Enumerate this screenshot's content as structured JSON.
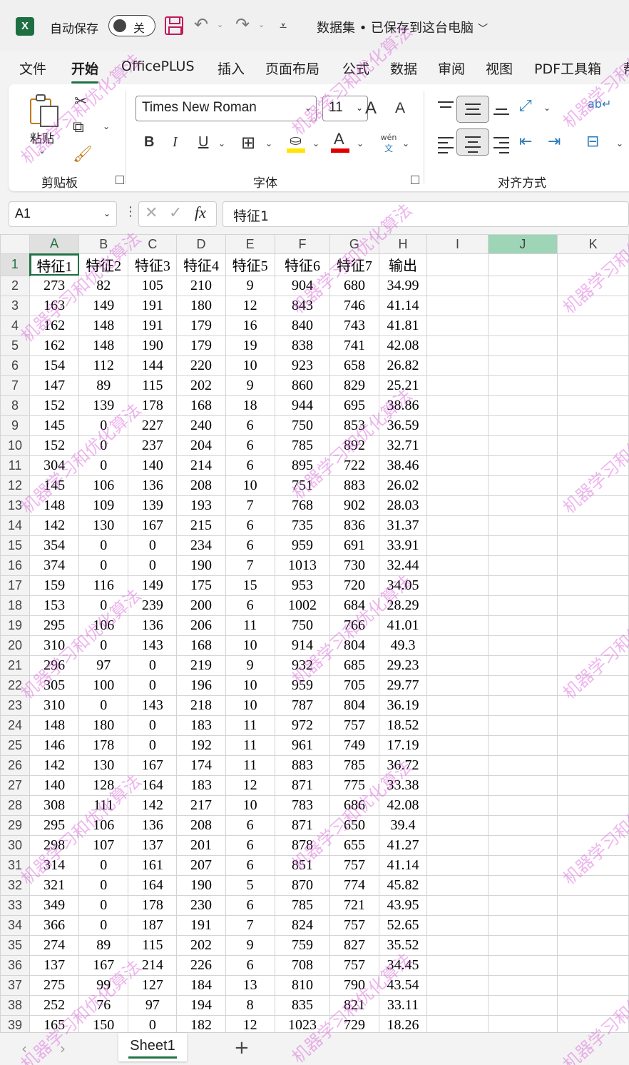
{
  "titlebar": {
    "app_logo": "X",
    "autosave_label": "自动保存",
    "autosave_state": "关",
    "doc_title": "数据集 • 已保存到这台电脑",
    "icons": [
      "save-icon",
      "undo-icon",
      "redo-icon",
      "customize-qat-icon"
    ]
  },
  "ribbon_tabs": [
    {
      "label": "文件",
      "active": false
    },
    {
      "label": "开始",
      "active": true
    },
    {
      "label": "OfficePLUS",
      "active": false
    },
    {
      "label": "插入",
      "active": false
    },
    {
      "label": "页面布局",
      "active": false
    },
    {
      "label": "公式",
      "active": false
    },
    {
      "label": "数据",
      "active": false
    },
    {
      "label": "审阅",
      "active": false
    },
    {
      "label": "视图",
      "active": false
    },
    {
      "label": "PDF工具箱",
      "active": false
    },
    {
      "label": "帮",
      "active": false
    }
  ],
  "ribbon": {
    "clipboard": {
      "paste_label": "粘贴",
      "group_label": "剪贴板"
    },
    "font": {
      "font_name": "Times New Roman",
      "font_size": "11",
      "group_label": "字体",
      "bold": "B",
      "italic": "I",
      "underline": "U",
      "font_color_glyph": "A",
      "grow": "A",
      "shrink": "A",
      "phonetic": "wén",
      "phonetic2": "文"
    },
    "alignment": {
      "group_label": "对齐方式"
    }
  },
  "formula_bar": {
    "name_box": "A1",
    "formula": "特征1",
    "fx": "fx"
  },
  "grid": {
    "columns": [
      "A",
      "B",
      "C",
      "D",
      "E",
      "F",
      "G",
      "H",
      "I",
      "J",
      "K"
    ],
    "headers": [
      "特征1",
      "特征2",
      "特征3",
      "特征4",
      "特征5",
      "特征6",
      "特征7",
      "输出"
    ],
    "rows": [
      [
        273,
        82,
        105,
        210,
        9,
        904,
        680,
        "34.99"
      ],
      [
        163,
        149,
        191,
        180,
        12,
        843,
        746,
        "41.14"
      ],
      [
        162,
        148,
        191,
        179,
        16,
        840,
        743,
        "41.81"
      ],
      [
        162,
        148,
        190,
        179,
        19,
        838,
        741,
        "42.08"
      ],
      [
        154,
        112,
        144,
        220,
        10,
        923,
        658,
        "26.82"
      ],
      [
        147,
        89,
        115,
        202,
        9,
        860,
        829,
        "25.21"
      ],
      [
        152,
        139,
        178,
        168,
        18,
        944,
        695,
        "38.86"
      ],
      [
        145,
        0,
        227,
        240,
        6,
        750,
        853,
        "36.59"
      ],
      [
        152,
        0,
        237,
        204,
        6,
        785,
        892,
        "32.71"
      ],
      [
        304,
        0,
        140,
        214,
        6,
        895,
        722,
        "38.46"
      ],
      [
        145,
        106,
        136,
        208,
        10,
        751,
        883,
        "26.02"
      ],
      [
        148,
        109,
        139,
        193,
        7,
        768,
        902,
        "28.03"
      ],
      [
        142,
        130,
        167,
        215,
        6,
        735,
        836,
        "31.37"
      ],
      [
        354,
        0,
        0,
        234,
        6,
        959,
        691,
        "33.91"
      ],
      [
        374,
        0,
        0,
        190,
        7,
        1013,
        730,
        "32.44"
      ],
      [
        159,
        116,
        149,
        175,
        15,
        953,
        720,
        "34.05"
      ],
      [
        153,
        0,
        239,
        200,
        6,
        1002,
        684,
        "28.29"
      ],
      [
        295,
        106,
        136,
        206,
        11,
        750,
        766,
        "41.01"
      ],
      [
        310,
        0,
        143,
        168,
        10,
        914,
        804,
        "49.3"
      ],
      [
        296,
        97,
        0,
        219,
        9,
        932,
        685,
        "29.23"
      ],
      [
        305,
        100,
        0,
        196,
        10,
        959,
        705,
        "29.77"
      ],
      [
        310,
        0,
        143,
        218,
        10,
        787,
        804,
        "36.19"
      ],
      [
        148,
        180,
        0,
        183,
        11,
        972,
        757,
        "18.52"
      ],
      [
        146,
        178,
        0,
        192,
        11,
        961,
        749,
        "17.19"
      ],
      [
        142,
        130,
        167,
        174,
        11,
        883,
        785,
        "36.72"
      ],
      [
        140,
        128,
        164,
        183,
        12,
        871,
        775,
        "33.38"
      ],
      [
        308,
        111,
        142,
        217,
        10,
        783,
        686,
        "42.08"
      ],
      [
        295,
        106,
        136,
        208,
        6,
        871,
        650,
        "39.4"
      ],
      [
        298,
        107,
        137,
        201,
        6,
        878,
        655,
        "41.27"
      ],
      [
        314,
        0,
        161,
        207,
        6,
        851,
        757,
        "41.14"
      ],
      [
        321,
        0,
        164,
        190,
        5,
        870,
        774,
        "45.82"
      ],
      [
        349,
        0,
        178,
        230,
        6,
        785,
        721,
        "43.95"
      ],
      [
        366,
        0,
        187,
        191,
        7,
        824,
        757,
        "52.65"
      ],
      [
        274,
        89,
        115,
        202,
        9,
        759,
        827,
        "35.52"
      ],
      [
        137,
        167,
        214,
        226,
        6,
        708,
        757,
        "34.45"
      ],
      [
        275,
        99,
        127,
        184,
        13,
        810,
        790,
        "43.54"
      ],
      [
        252,
        76,
        97,
        194,
        8,
        835,
        821,
        "33.11"
      ],
      [
        165,
        150,
        0,
        182,
        12,
        1023,
        729,
        "18.26"
      ]
    ]
  },
  "sheets": {
    "tabs": [
      "Sheet1"
    ],
    "add": "+"
  },
  "watermark": "机器学习和优化算法",
  "colors": {
    "accent": "#217346",
    "watermark": "#d650d6",
    "highlight_col": "#9fd5b7"
  }
}
